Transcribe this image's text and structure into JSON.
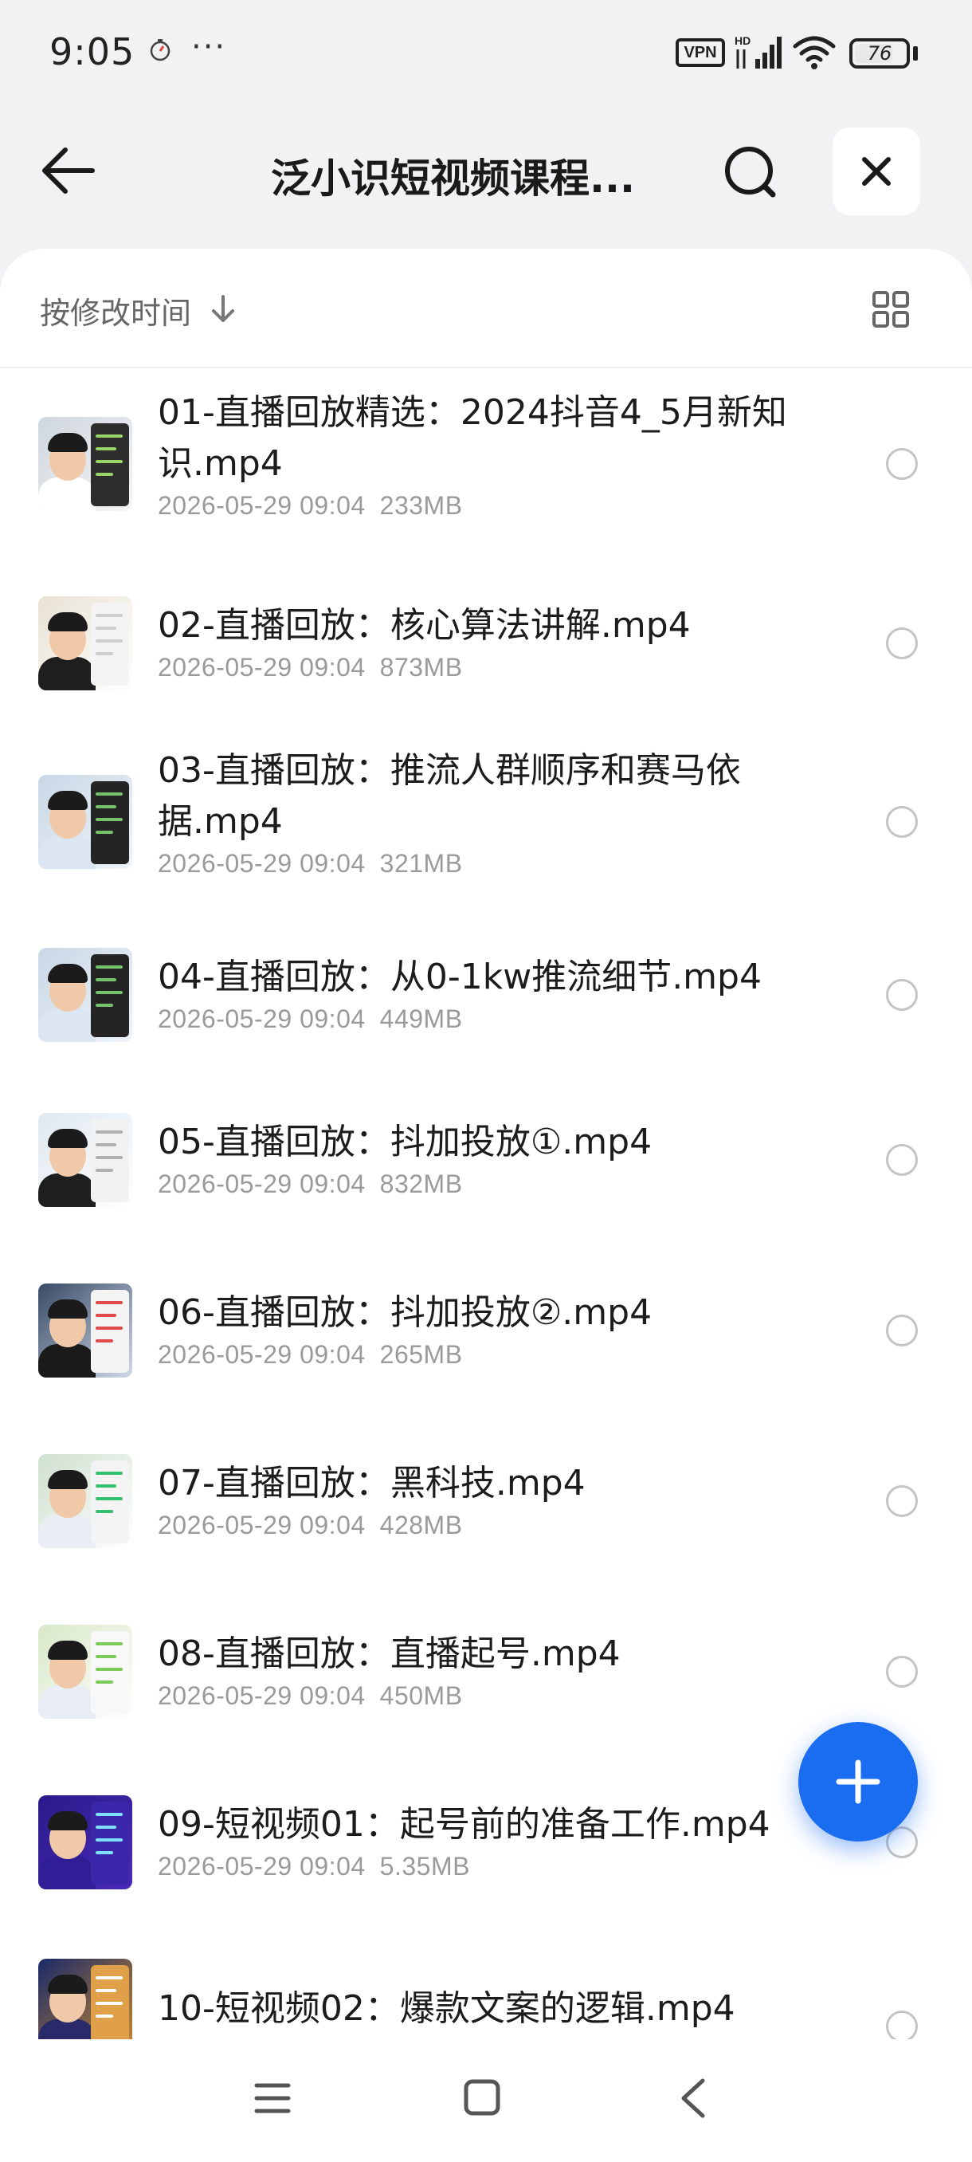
{
  "status_bar": {
    "time": "9:05",
    "app_icon": "stopwatch-icon",
    "more": "···",
    "vpn_label": "VPN",
    "battery_level": "76",
    "battery_fraction": 0.76
  },
  "header": {
    "title": "泛小识短视频课程...",
    "back_icon": "arrow-left-icon",
    "search_icon": "search-icon",
    "close_icon": "close-icon"
  },
  "sort_bar": {
    "label": "按修改时间",
    "direction_icon": "arrow-down-icon",
    "view_toggle_icon": "grid-view-icon"
  },
  "files": [
    {
      "name": "01-直播回放精选：2024抖音4_5月新知识.mp4",
      "date": "2026-05-29 09:04",
      "size": "233MB",
      "selected": false
    },
    {
      "name": "02-直播回放：核心算法讲解.mp4",
      "date": "2026-05-29 09:04",
      "size": "873MB",
      "selected": false
    },
    {
      "name": "03-直播回放：推流人群顺序和赛马依据.mp4",
      "date": "2026-05-29 09:04",
      "size": "321MB",
      "selected": false
    },
    {
      "name": "04-直播回放：从0-1kw推流细节.mp4",
      "date": "2026-05-29 09:04",
      "size": "449MB",
      "selected": false
    },
    {
      "name": "05-直播回放：抖加投放①.mp4",
      "date": "2026-05-29 09:04",
      "size": "832MB",
      "selected": false
    },
    {
      "name": "06-直播回放：抖加投放②.mp4",
      "date": "2026-05-29 09:04",
      "size": "265MB",
      "selected": false
    },
    {
      "name": "07-直播回放：黑科技.mp4",
      "date": "2026-05-29 09:04",
      "size": "428MB",
      "selected": false
    },
    {
      "name": "08-直播回放：直播起号.mp4",
      "date": "2026-05-29 09:04",
      "size": "450MB",
      "selected": false
    },
    {
      "name": "09-短视频01：起号前的准备工作.mp4",
      "date": "2026-05-29 09:04",
      "size": "5.35MB",
      "selected": false
    },
    {
      "name": "10-短视频02：爆款文案的逻辑.mp4",
      "date": "",
      "size": "",
      "selected": false
    }
  ],
  "fab": {
    "icon": "plus-icon"
  },
  "nav_bar": {
    "menu_icon": "menu-icon",
    "home_icon": "home-square-icon",
    "back_icon": "back-chevron-icon"
  },
  "colors": {
    "accent": "#1a6cf0",
    "page_bg": "#f2f2f4",
    "meta_text": "#9a9a9a"
  }
}
